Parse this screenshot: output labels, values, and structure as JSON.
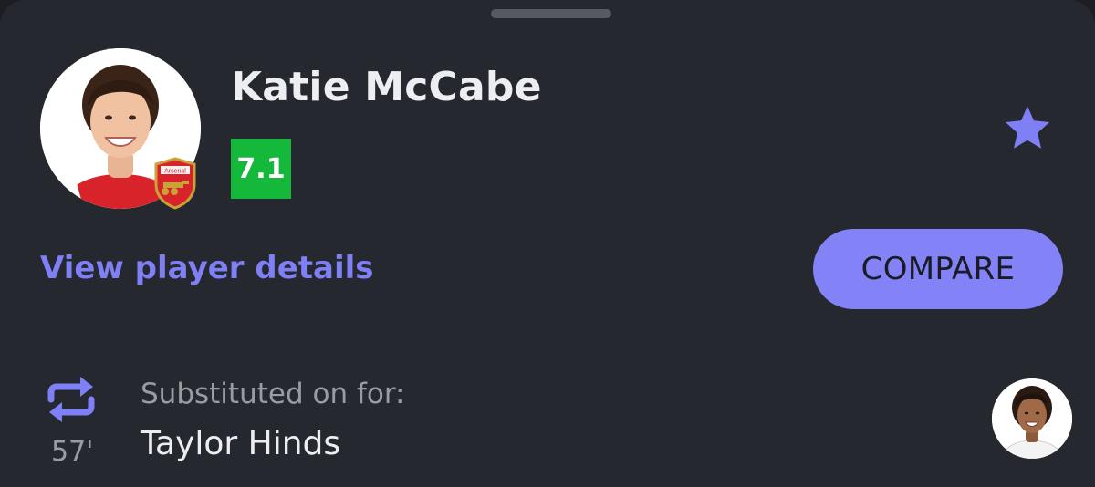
{
  "player": {
    "name": "Katie McCabe",
    "rating": "7.1",
    "club_badge_text": "Arsenal"
  },
  "actions": {
    "view_details_label": "View player details",
    "compare_label": "COMPARE",
    "favorite_icon": "star-icon"
  },
  "substitution": {
    "icon": "substitution-icon",
    "minute": "57'",
    "label": "Substituted on for:",
    "player_name": "Taylor Hinds"
  },
  "colors": {
    "background": "#25282f",
    "accent": "#8383f7",
    "rating_green": "#14b83a",
    "text_primary": "#eceef2",
    "text_secondary": "#9a9ca3"
  }
}
